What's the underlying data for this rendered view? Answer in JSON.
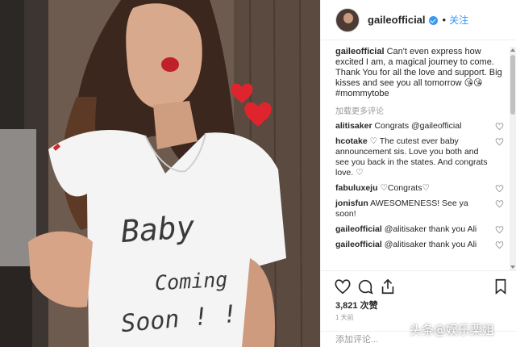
{
  "post": {
    "photo_text": {
      "line1": "Baby",
      "line2": "Coming",
      "line3": "Soon ! !"
    }
  },
  "header": {
    "username": "gaileofficial",
    "separator": "•",
    "follow_label": "关注"
  },
  "caption": {
    "username": "gaileofficial",
    "text": "Can't even express how excited I am, a magical journey to come. Thank You for all the love and support. Big kisses and see you all tomorrow 😘😘#mommytobe"
  },
  "load_more_label": "加载更多评论",
  "comments": [
    {
      "username": "alitisaker",
      "text": "Congrats @gaileofficial"
    },
    {
      "username": "hcotake",
      "text": "♡ The cutest ever baby announcement sis. Love you both and see you back in the states. And congrats love. ♡"
    },
    {
      "username": "fabuluxeju",
      "text": "♡Congrats♡"
    },
    {
      "username": "jonisfun",
      "text": "AWESOMENESS! See ya soon!"
    },
    {
      "username": "gaileofficial",
      "text": "@alitisaker thank you Ali"
    },
    {
      "username": "gaileofficial",
      "text": "@alitisaker thank you Ali"
    }
  ],
  "actions": {
    "likes": "3,821 次赞",
    "time": "1 天前",
    "add_comment_placeholder": "添加评论..."
  },
  "watermark": "头条@娱乐栗姐",
  "icons": [
    "verified-icon",
    "heart-icon",
    "comment-icon",
    "share-icon",
    "bookmark-icon"
  ],
  "colors": {
    "accent": "#3897f0",
    "heart": "#e0242e",
    "muted": "#999999"
  }
}
